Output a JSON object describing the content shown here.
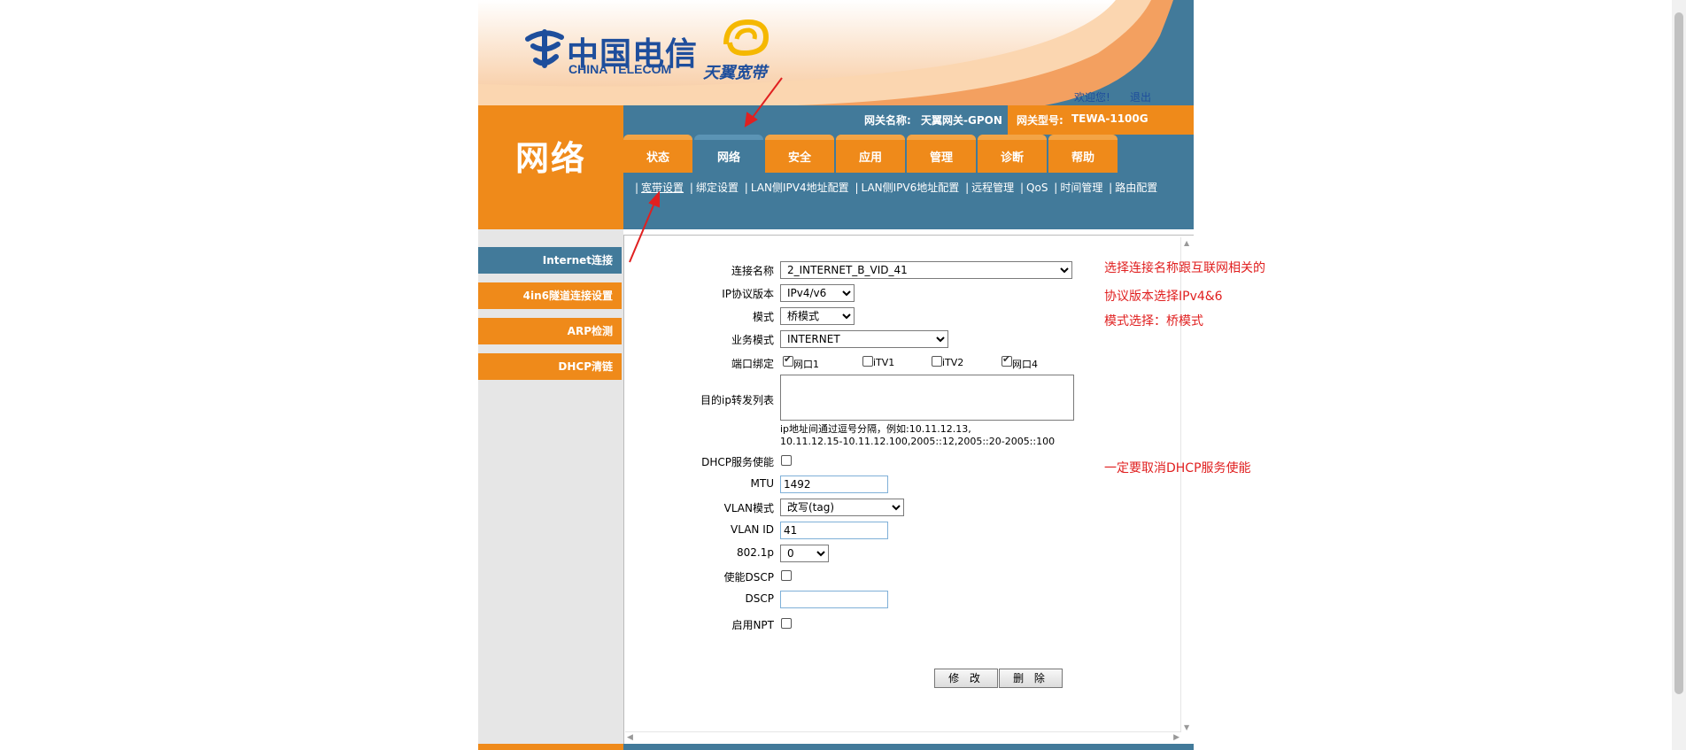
{
  "header": {
    "brand_cn": "中国电信",
    "brand_en": "CHINA TELECOM",
    "sub_brand": "天翼宽带",
    "welcome": "欢迎您!",
    "logout": "退出"
  },
  "info_bar": {
    "gateway_name_label": "网关名称:",
    "gateway_name": "天翼网关-GPON",
    "gateway_model_label": "网关型号:",
    "gateway_model": "TEWA-1100G"
  },
  "section_title": "网络",
  "nav_tabs": [
    "状态",
    "网络",
    "安全",
    "应用",
    "管理",
    "诊断",
    "帮助"
  ],
  "sub_nav": [
    "宽带设置",
    "绑定设置",
    "LAN侧IPV4地址配置",
    "LAN侧IPV6地址配置",
    "远程管理",
    "QoS",
    "时间管理",
    "路由配置"
  ],
  "left_menu": [
    "Internet连接",
    "4in6隧道连接设置",
    "ARP检测",
    "DHCP清链"
  ],
  "form": {
    "connection_name": {
      "label": "连接名称",
      "value": "2_INTERNET_B_VID_41"
    },
    "ip_version": {
      "label": "IP协议版本",
      "value": "IPv4/v6"
    },
    "mode": {
      "label": "模式",
      "value": "桥模式"
    },
    "service_mode": {
      "label": "业务模式",
      "value": "INTERNET"
    },
    "port_binding": {
      "label": "端口绑定",
      "ports": [
        "网口1",
        "iTV1",
        "iTV2",
        "网口4"
      ]
    },
    "dest_ip_list": {
      "label": "目的ip转发列表"
    },
    "hint_line1": "ip地址间通过逗号分隔，例如:10.11.12.13,",
    "hint_line2": "10.11.12.15-10.11.12.100,2005::12,2005::20-2005::100",
    "dhcp_enable": {
      "label": "DHCP服务使能"
    },
    "mtu": {
      "label": "MTU",
      "value": "1492"
    },
    "vlan_mode": {
      "label": "VLAN模式",
      "value": "改写(tag)"
    },
    "vlan_id": {
      "label": "VLAN ID",
      "value": "41"
    },
    "dot1p": {
      "label": "802.1p",
      "value": "0"
    },
    "enable_dscp": {
      "label": "使能DSCP"
    },
    "dscp": {
      "label": "DSCP",
      "value": ""
    },
    "enable_npt": {
      "label": "启用NPT"
    }
  },
  "buttons": {
    "modify": "修 改",
    "delete": "删 除"
  },
  "annotations": {
    "note1": "选择连接名称跟互联网相关的",
    "note2": "协议版本选择IPv4&6",
    "note3": "模式选择：桥模式",
    "note4": "一定要取消DHCP服务使能"
  },
  "colors": {
    "orange": "#ef8a1a",
    "blue": "#427a9a",
    "annotation_red": "#e02020",
    "brand_blue": "#1e4e9c"
  }
}
